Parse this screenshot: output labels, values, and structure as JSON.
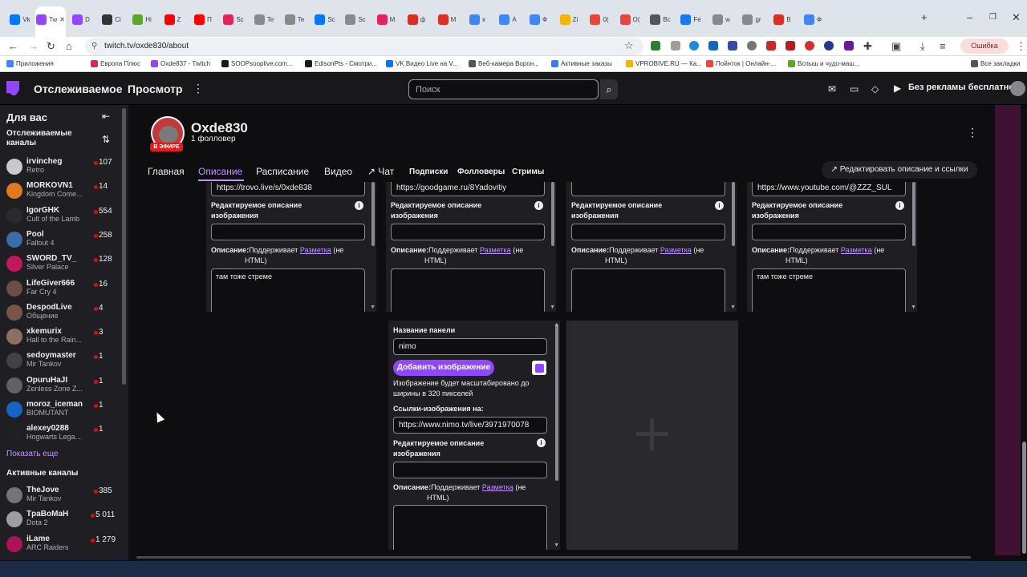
{
  "browser": {
    "tabs": [
      {
        "label": "Vk",
        "color": "#0077ff"
      },
      {
        "label": "Tw",
        "color": "#9147ff",
        "active": true
      },
      {
        "label": "D",
        "color": "#9147ff"
      },
      {
        "label": "Ci",
        "color": "#333333"
      },
      {
        "label": "Hi",
        "color": "#5ba829"
      },
      {
        "label": "Z",
        "color": "#ff0000"
      },
      {
        "label": "П",
        "color": "#ff0000"
      },
      {
        "label": "Sc",
        "color": "#e0245e"
      },
      {
        "label": "Te",
        "color": "#8a8a8a"
      },
      {
        "label": "Te",
        "color": "#8a8a8a"
      },
      {
        "label": "Sc",
        "color": "#0077ff"
      },
      {
        "label": "Sc",
        "color": "#8a8a8a"
      },
      {
        "label": "M",
        "color": "#e0245e"
      },
      {
        "label": "ф",
        "color": "#d93025"
      },
      {
        "label": "M",
        "color": "#d93025"
      },
      {
        "label": "к",
        "color": "#4285f4"
      },
      {
        "label": "A",
        "color": "#4285f4"
      },
      {
        "label": "Ф",
        "color": "#4285f4"
      },
      {
        "label": "Zi",
        "color": "#f4b400"
      },
      {
        "label": "0(",
        "color": "#e8453c"
      },
      {
        "label": "O(",
        "color": "#e8453c"
      },
      {
        "label": "Bc",
        "color": "#555555"
      },
      {
        "label": "Fe",
        "color": "#1877f2"
      },
      {
        "label": "w",
        "color": "#8a8a8a"
      },
      {
        "label": "gr",
        "color": "#8a8a8a"
      },
      {
        "label": "B",
        "color": "#d93025"
      },
      {
        "label": "Ф",
        "color": "#4285f4"
      }
    ],
    "new_tab": "+",
    "url": "twitch.tv/oxde830/about",
    "error_label": "Ошибка",
    "bookmarks": [
      {
        "label": "Приложения",
        "color": "#4285f4"
      },
      {
        "label": "Европа Плюс",
        "color": "#e0245e"
      },
      {
        "label": "Oxde837 - Twitch",
        "color": "#9147ff"
      },
      {
        "label": "SOOPsooplive.com...",
        "color": "#1a1a1a"
      },
      {
        "label": "EdisonPts - Смотри...",
        "color": "#1a1a1a"
      },
      {
        "label": "VK Видео Live на V...",
        "color": "#0077ff"
      },
      {
        "label": "Веб-камера Ворон...",
        "color": "#555555"
      },
      {
        "label": "Активные заказы",
        "color": "#2d7ff9"
      },
      {
        "label": "VPROBIVE.RU — Ка...",
        "color": "#f4b400"
      },
      {
        "label": "Пойнток | Онлайн-...",
        "color": "#e8453c"
      },
      {
        "label": "Вспыш и чудо-маш...",
        "color": "#5ba829"
      },
      {
        "label": "Все закладки",
        "color": "#555555"
      }
    ]
  },
  "twitch_nav": {
    "following": "Отслеживаемое",
    "browse": "Просмотр",
    "more": "⋮",
    "search_placeholder": "Поиск",
    "search_icon": "⌕",
    "no_ads": "Без рекламы бесплатно"
  },
  "sidebar": {
    "title": "Для вас",
    "collapse_icon": "⇤",
    "followed_label": "Отслеживаемые каналы",
    "sort_icon": "⇅",
    "followed": [
      {
        "name": "irvincheg",
        "game": "Retro",
        "viewers": "107",
        "color": "#c9c9c9"
      },
      {
        "name": "MORKOVN1",
        "game": "Kingdom Come...",
        "viewers": "14",
        "color": "#e07a1f"
      },
      {
        "name": "IgorGHK",
        "game": "Cult of the Lamb",
        "viewers": "554",
        "color": "#2a2a2a"
      },
      {
        "name": "Pool",
        "game": "Fallout 4",
        "viewers": "258",
        "color": "#3a6ea5"
      },
      {
        "name": "SWORD_TV_",
        "game": "Silver Palace",
        "viewers": "128",
        "color": "#c2185b"
      },
      {
        "name": "LifeGiver666",
        "game": "Far Cry 4",
        "viewers": "16",
        "color": "#6d4c41"
      },
      {
        "name": "DespodLive",
        "game": "Общение",
        "viewers": "4",
        "color": "#795548"
      },
      {
        "name": "xkemurix",
        "game": "Hall to the Rain...",
        "viewers": "3",
        "color": "#8d6e63"
      },
      {
        "name": "sedoymaster",
        "game": "Mir Tankov",
        "viewers": "1",
        "color": "#424242"
      },
      {
        "name": "OpuruHaJI",
        "game": "Zenless Zone Z...",
        "viewers": "1",
        "color": "#616161"
      },
      {
        "name": "moroz_iceman",
        "game": "BIOMUTANT",
        "viewers": "1",
        "color": "#1565c0"
      },
      {
        "name": "alexey0288",
        "game": "Hogwarts Lega...",
        "viewers": "1",
        "color": "#212121"
      }
    ],
    "show_more": "Показать еще",
    "active_label": "Активные каналы",
    "active": [
      {
        "name": "TheJove",
        "game": "Mir Tankov",
        "viewers": "385",
        "color": "#757575"
      },
      {
        "name": "TpaBoMaH",
        "game": "Dota 2",
        "viewers": "5 011",
        "color": "#9e9e9e"
      },
      {
        "name": "iLame",
        "game": "ARC Raiders",
        "viewers": "1 279",
        "color": "#ad1457"
      }
    ]
  },
  "channel": {
    "name": "Oxde830",
    "followers": "1 фолловер",
    "live_badge": "В ЭФИРЕ",
    "more": "⋮",
    "tabs": {
      "home": "Главная",
      "about": "Описание",
      "schedule": "Расписание",
      "videos": "Видео",
      "chat": "↗ Чат",
      "subs": "Подписки",
      "followers": "Фолловеры",
      "streams": "Стримы"
    },
    "edit_button": "↗ Редактировать описание и ссылки"
  },
  "panels_top": [
    {
      "link": "https://trovo.live/s/0xde838",
      "alt": "",
      "desc_text": "там тоже стреме"
    },
    {
      "link": "https://goodgame.ru/8Yadovitiy",
      "alt": "",
      "desc_text": ""
    },
    {
      "link": "",
      "alt": "",
      "desc_text": ""
    },
    {
      "link": "https://www.youtube.com/@ZZZ_SUL",
      "alt": "",
      "desc_text": "там тоже стреме"
    }
  ],
  "labels": {
    "alt_label": "Редактируемое описание изображения",
    "desc_prefix": "Описание:",
    "desc_mid": "Поддерживает ",
    "desc_link": "Разметка",
    "desc_suffix": " (не",
    "desc_html": "HTML)",
    "info": "i"
  },
  "panel_edit": {
    "title_label": "Название панели",
    "title_value": "nimo",
    "add_image": "Добавить изображение",
    "scale_note": "Изображение будет масштабировано до ширины в 320 пикселей",
    "link_label": "Ссылки-изображения на:",
    "link_value": "https://www.nimo.tv/live/3971970078",
    "alt_value": "",
    "desc_value": ""
  }
}
